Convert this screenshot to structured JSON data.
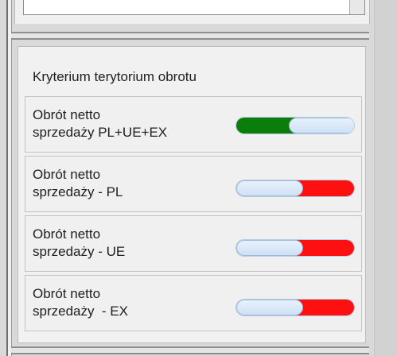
{
  "panel": {
    "title": "Kryterium terytorium obrotu"
  },
  "rows": [
    {
      "label": "Obrót netto\nsprzedaży PL+UE+EX",
      "toggle_state": "on",
      "on_color": "#0b7d0b"
    },
    {
      "label": "Obrót netto\nsprzedaży - PL",
      "toggle_state": "off",
      "off_color": "#ff1010"
    },
    {
      "label": "Obrót netto\nsprzedaży - UE",
      "toggle_state": "off",
      "off_color": "#ff1010"
    },
    {
      "label": "Obrót netto\nsprzedaży  - EX",
      "toggle_state": "off",
      "off_color": "#ff1010"
    }
  ]
}
